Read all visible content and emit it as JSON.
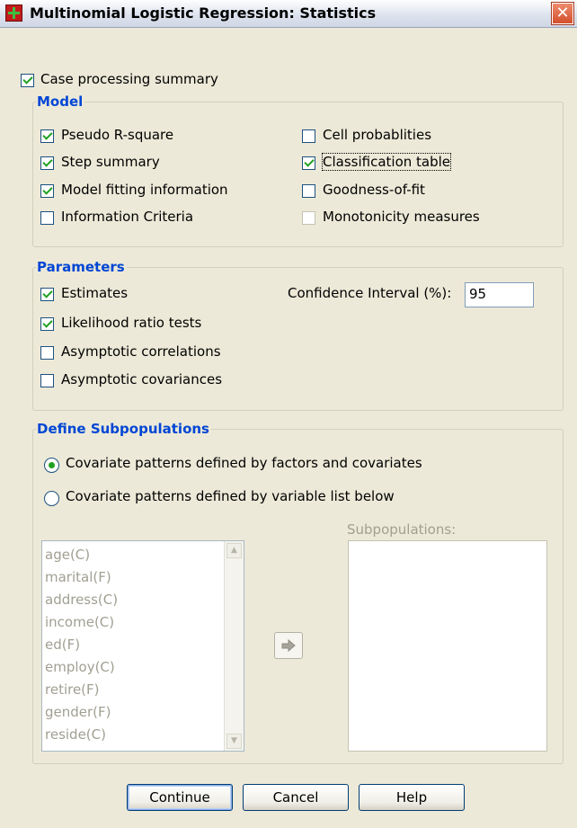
{
  "window": {
    "title": "Multinomial Logistic Regression: Statistics",
    "close_symbol": "✕"
  },
  "case_processing": {
    "label": "Case processing summary",
    "checked": true
  },
  "model": {
    "title": "Model",
    "left": [
      {
        "label": "Pseudo R-square",
        "checked": true
      },
      {
        "label": "Step summary",
        "checked": true
      },
      {
        "label": "Model fitting information",
        "checked": true
      },
      {
        "label": "Information Criteria",
        "checked": false
      }
    ],
    "right": [
      {
        "label": "Cell probablities",
        "checked": false,
        "enabled": true
      },
      {
        "label": "Classification table",
        "checked": true,
        "enabled": true
      },
      {
        "label": "Goodness-of-fit",
        "checked": false,
        "enabled": true
      },
      {
        "label": "Monotonicity measures",
        "checked": false,
        "enabled": false
      }
    ]
  },
  "parameters": {
    "title": "Parameters",
    "items": [
      {
        "label": "Estimates",
        "checked": true
      },
      {
        "label": "Likelihood ratio tests",
        "checked": true
      },
      {
        "label": "Asymptotic correlations",
        "checked": false
      },
      {
        "label": "Asymptotic covariances",
        "checked": false
      }
    ],
    "confidence_label": "Confidence Interval (%):",
    "confidence_value": "95"
  },
  "subpopulations": {
    "title": "Define Subpopulations",
    "radio_factors": {
      "label": "Covariate patterns defined by factors and covariates",
      "selected": true
    },
    "radio_varlist": {
      "label": "Covariate patterns defined by variable list below",
      "selected": false
    },
    "variables": [
      "age(C)",
      "marital(F)",
      "address(C)",
      "income(C)",
      "ed(F)",
      "employ(C)",
      "retire(F)",
      "gender(F)",
      "reside(C)"
    ],
    "subpop_label": "Subpopulations:",
    "subpop_items": []
  },
  "buttons": {
    "continue": "Continue",
    "cancel": "Cancel",
    "help": "Help"
  },
  "colors": {
    "dialog_bg": "#ece9d8",
    "group_title": "#0046d5",
    "checkmark": "#21a121",
    "disabled_text": "#a19f92"
  },
  "icons": {
    "app": "spss-dialog-icon",
    "close": "close-icon",
    "move_arrow": "right-arrow-icon"
  }
}
